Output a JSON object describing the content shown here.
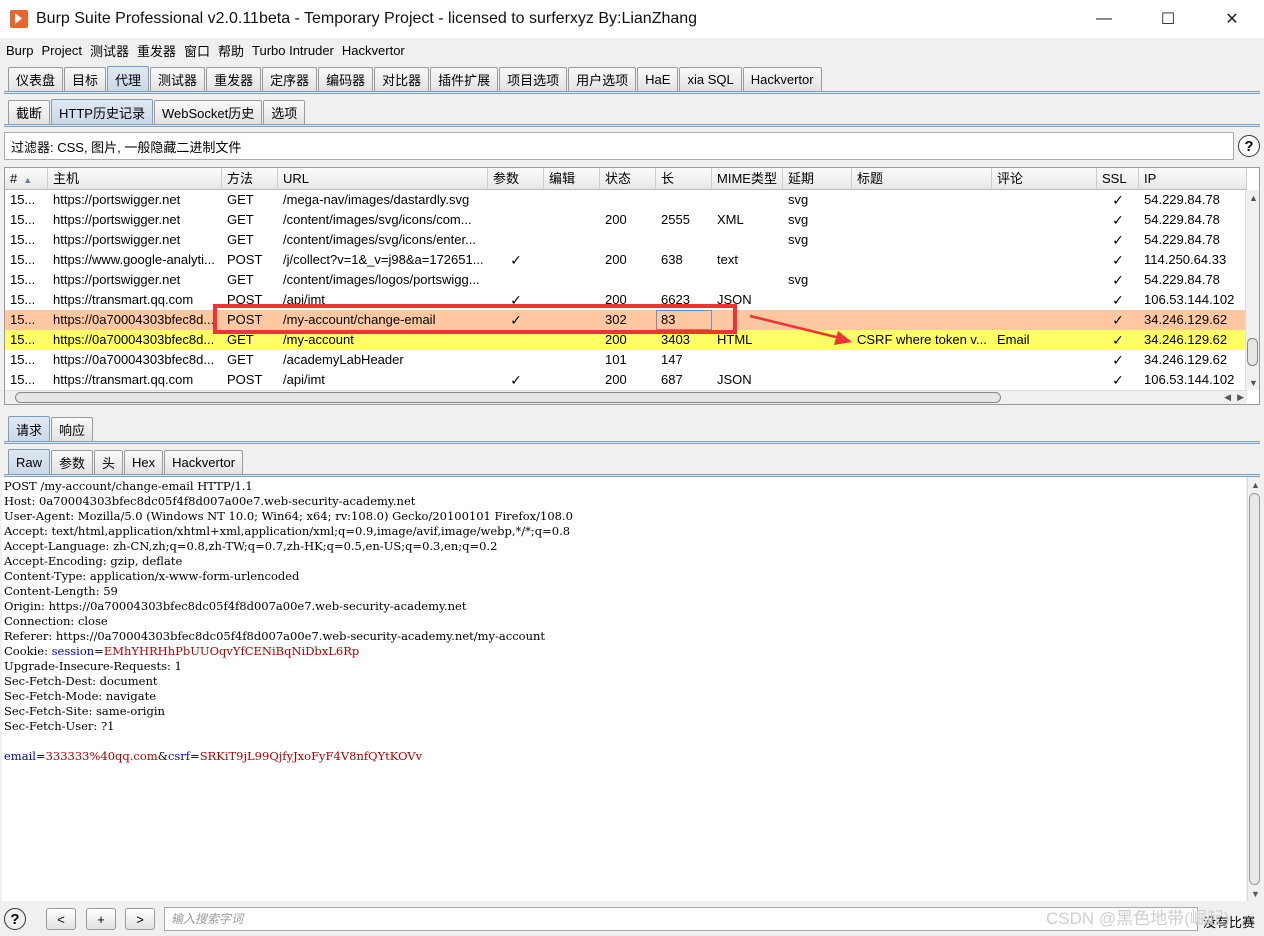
{
  "window": {
    "title": "Burp Suite Professional v2.0.11beta - Temporary Project - licensed to surferxyz By:LianZhang",
    "minimize": "—",
    "maximize": "☐",
    "close": "✕"
  },
  "menu": [
    "Burp",
    "Project",
    "测试器",
    "重发器",
    "窗口",
    "帮助",
    "Turbo Intruder",
    "Hackvertor"
  ],
  "main_tabs": [
    "仪表盘",
    "目标",
    "代理",
    "测试器",
    "重发器",
    "定序器",
    "编码器",
    "对比器",
    "插件扩展",
    "项目选项",
    "用户选项",
    "HaE",
    "xia SQL",
    "Hackvertor"
  ],
  "main_tab_active": "代理",
  "proxy_tabs": [
    "截断",
    "HTTP历史记录",
    "WebSocket历史",
    "选项"
  ],
  "proxy_tab_active": "HTTP历史记录",
  "filter": {
    "text": "过滤器: CSS, 图片, 一般隐藏二进制文件",
    "help": "?"
  },
  "table": {
    "sort_indicator": "▲",
    "columns": [
      "#",
      "主机",
      "方法",
      "URL",
      "参数",
      "编辑",
      "状态",
      "长",
      "MIME类型",
      "延期",
      "标题",
      "评论",
      "SSL",
      "IP"
    ],
    "rows": [
      {
        "num": "15...",
        "host": "https://portswigger.net",
        "method": "GET",
        "url": "/mega-nav/images/dastardly.svg",
        "params": "",
        "edited": "",
        "status": "",
        "length": "",
        "mime": "",
        "ext": "svg",
        "title": "",
        "comment": "",
        "ssl": "✓",
        "ip": "54.229.84.78",
        "hl": ""
      },
      {
        "num": "15...",
        "host": "https://portswigger.net",
        "method": "GET",
        "url": "/content/images/svg/icons/com...",
        "params": "",
        "edited": "",
        "status": "200",
        "length": "2555",
        "mime": "XML",
        "ext": "svg",
        "title": "",
        "comment": "",
        "ssl": "✓",
        "ip": "54.229.84.78",
        "hl": ""
      },
      {
        "num": "15...",
        "host": "https://portswigger.net",
        "method": "GET",
        "url": "/content/images/svg/icons/enter...",
        "params": "",
        "edited": "",
        "status": "",
        "length": "",
        "mime": "",
        "ext": "svg",
        "title": "",
        "comment": "",
        "ssl": "✓",
        "ip": "54.229.84.78",
        "hl": ""
      },
      {
        "num": "15...",
        "host": "https://www.google-analyti...",
        "method": "POST",
        "url": "/j/collect?v=1&_v=j98&a=172651...",
        "params": "✓",
        "edited": "",
        "status": "200",
        "length": "638",
        "mime": "text",
        "ext": "",
        "title": "",
        "comment": "",
        "ssl": "✓",
        "ip": "114.250.64.33",
        "hl": ""
      },
      {
        "num": "15...",
        "host": "https://portswigger.net",
        "method": "GET",
        "url": "/content/images/logos/portswigg...",
        "params": "",
        "edited": "",
        "status": "",
        "length": "",
        "mime": "",
        "ext": "svg",
        "title": "",
        "comment": "",
        "ssl": "✓",
        "ip": "54.229.84.78",
        "hl": ""
      },
      {
        "num": "15...",
        "host": "https://transmart.qq.com",
        "method": "POST",
        "url": "/api/imt",
        "params": "✓",
        "edited": "",
        "status": "200",
        "length": "6623",
        "mime": "JSON",
        "ext": "",
        "title": "",
        "comment": "",
        "ssl": "✓",
        "ip": "106.53.144.102",
        "hl": ""
      },
      {
        "num": "15...",
        "host": "https://0a70004303bfec8d...",
        "method": "POST",
        "url": "/my-account/change-email",
        "params": "✓",
        "edited": "",
        "status": "302",
        "length": "83",
        "mime": "",
        "ext": "",
        "title": "",
        "comment": "",
        "ssl": "✓",
        "ip": "34.246.129.62",
        "hl": "orange"
      },
      {
        "num": "15...",
        "host": "https://0a70004303bfec8d...",
        "method": "GET",
        "url": "/my-account",
        "params": "",
        "edited": "",
        "status": "200",
        "length": "3403",
        "mime": "HTML",
        "ext": "",
        "title": "CSRF where token v...",
        "comment": "Email",
        "ssl": "✓",
        "ip": "34.246.129.62",
        "hl": "yellow"
      },
      {
        "num": "15...",
        "host": "https://0a70004303bfec8d...",
        "method": "GET",
        "url": "/academyLabHeader",
        "params": "",
        "edited": "",
        "status": "101",
        "length": "147",
        "mime": "",
        "ext": "",
        "title": "",
        "comment": "",
        "ssl": "✓",
        "ip": "34.246.129.62",
        "hl": ""
      },
      {
        "num": "15...",
        "host": "https://transmart.qq.com",
        "method": "POST",
        "url": "/api/imt",
        "params": "✓",
        "edited": "",
        "status": "200",
        "length": "687",
        "mime": "JSON",
        "ext": "",
        "title": "",
        "comment": "",
        "ssl": "✓",
        "ip": "106.53.144.102",
        "hl": ""
      }
    ]
  },
  "req_resp_tabs": [
    "请求",
    "响应"
  ],
  "req_resp_active": "请求",
  "view_tabs": [
    "Raw",
    "参数",
    "头",
    "Hex",
    "Hackvertor"
  ],
  "view_active": "Raw",
  "request": {
    "lines": [
      "POST /my-account/change-email HTTP/1.1",
      "Host: 0a70004303bfec8dc05f4f8d007a00e7.web-security-academy.net",
      "User-Agent: Mozilla/5.0 (Windows NT 10.0; Win64; x64; rv:108.0) Gecko/20100101 Firefox/108.0",
      "Accept: text/html,application/xhtml+xml,application/xml;q=0.9,image/avif,image/webp,*/*;q=0.8",
      "Accept-Language: zh-CN,zh;q=0.8,zh-TW;q=0.7,zh-HK;q=0.5,en-US;q=0.3,en;q=0.2",
      "Accept-Encoding: gzip, deflate",
      "Content-Type: application/x-www-form-urlencoded",
      "Content-Length: 59",
      "Origin: https://0a70004303bfec8dc05f4f8d007a00e7.web-security-academy.net",
      "Connection: close",
      "Referer: https://0a70004303bfec8dc05f4f8d007a00e7.web-security-academy.net/my-account"
    ],
    "cookie_prefix": "Cookie: ",
    "cookie_name": "session",
    "cookie_value": "EMhYHRHhPbUUOqvYfCENiBqNiDbxL6Rp",
    "lines2": [
      "Upgrade-Insecure-Requests: 1",
      "Sec-Fetch-Dest: document",
      "Sec-Fetch-Mode: navigate",
      "Sec-Fetch-Site: same-origin",
      "Sec-Fetch-User: ?1"
    ],
    "body": {
      "k1": "email",
      "v1": "333333%40qq.com",
      "amp": "&",
      "k2": "csrf",
      "v2": "SRKiT9jL99QjfyJxoFyF4V8nfQYtKOVv",
      "eq": "="
    }
  },
  "bottom": {
    "help": "?",
    "prev": "<",
    "add": "+",
    "next": ">",
    "search_placeholder": "输入搜索字词",
    "no_match": "没有比赛"
  },
  "watermark": "CSDN @黑色地带(崛起)"
}
